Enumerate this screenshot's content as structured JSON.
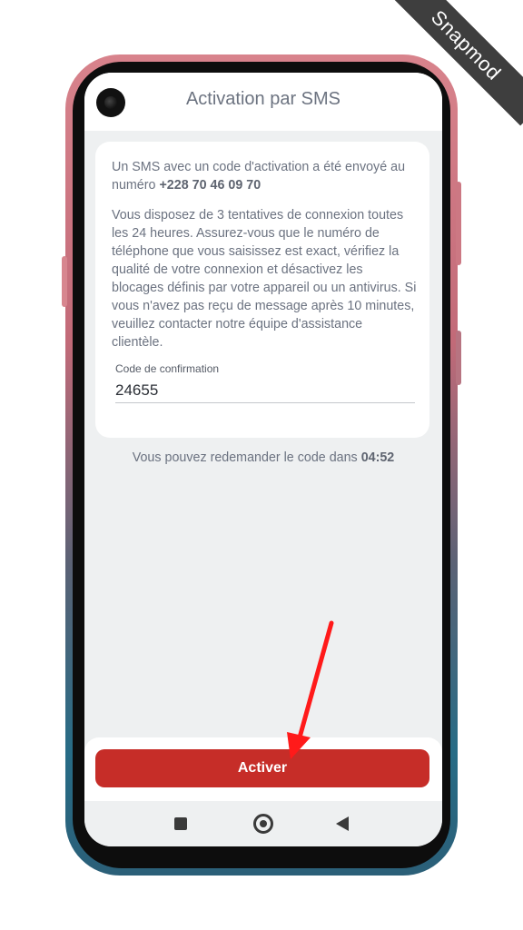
{
  "watermark": {
    "text": "Snapmod"
  },
  "appbar": {
    "title": "Activation par SMS"
  },
  "card": {
    "intro_prefix": "Un SMS avec un code d'activation a été envoyé au numéro ",
    "phone_number": "+228 70 46 09 70",
    "instructions": "Vous disposez de 3 tentatives de connexion toutes les 24 heures. Assurez-vous que le numéro de téléphone que vous saisissez est exact, vérifiez la qualité de votre connexion et désactivez les blocages définis par votre appareil ou un antivirus. Si vous n'avez pas reçu de message après 10 minutes, veuillez contacter notre équipe d'assistance clientèle.",
    "field_label": "Code de confirmation",
    "field_value": "24655"
  },
  "resend": {
    "prefix": "Vous pouvez redemander le code dans ",
    "timer": "04:52"
  },
  "actions": {
    "activate_label": "Activer"
  },
  "navbar": {
    "recents_icon": "square-icon",
    "home_icon": "circle-icon",
    "back_icon": "triangle-back-icon"
  },
  "colors": {
    "primary_button": "#c62d28",
    "annotation_arrow": "#ff1a1a",
    "screen_background": "#eef0f1",
    "text_secondary": "#6b7280"
  }
}
